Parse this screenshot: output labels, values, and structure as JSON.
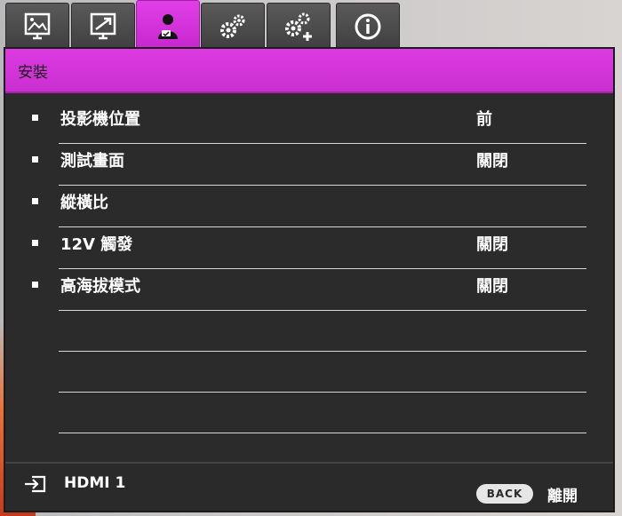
{
  "tabs": [
    {
      "icon": "picture-icon"
    },
    {
      "icon": "display-icon"
    },
    {
      "icon": "setup-person-icon",
      "active": true
    },
    {
      "icon": "gears-icon"
    },
    {
      "icon": "gears-plus-icon"
    },
    {
      "icon": "info-icon"
    }
  ],
  "header": {
    "title": "安裝"
  },
  "menu": {
    "items": [
      {
        "label": "投影機位置",
        "value": "前"
      },
      {
        "label": "測試畫面",
        "value": "關閉"
      },
      {
        "label": "縱橫比",
        "value": ""
      },
      {
        "label": "12V 觸發",
        "value": "關閉"
      },
      {
        "label": "高海拔模式",
        "value": "關閉"
      }
    ]
  },
  "footer": {
    "source": "HDMI 1",
    "back_button": "BACK",
    "back_label": "離開"
  },
  "colors": {
    "accent": "#d43ad9",
    "panel": "#2b2b2b"
  }
}
